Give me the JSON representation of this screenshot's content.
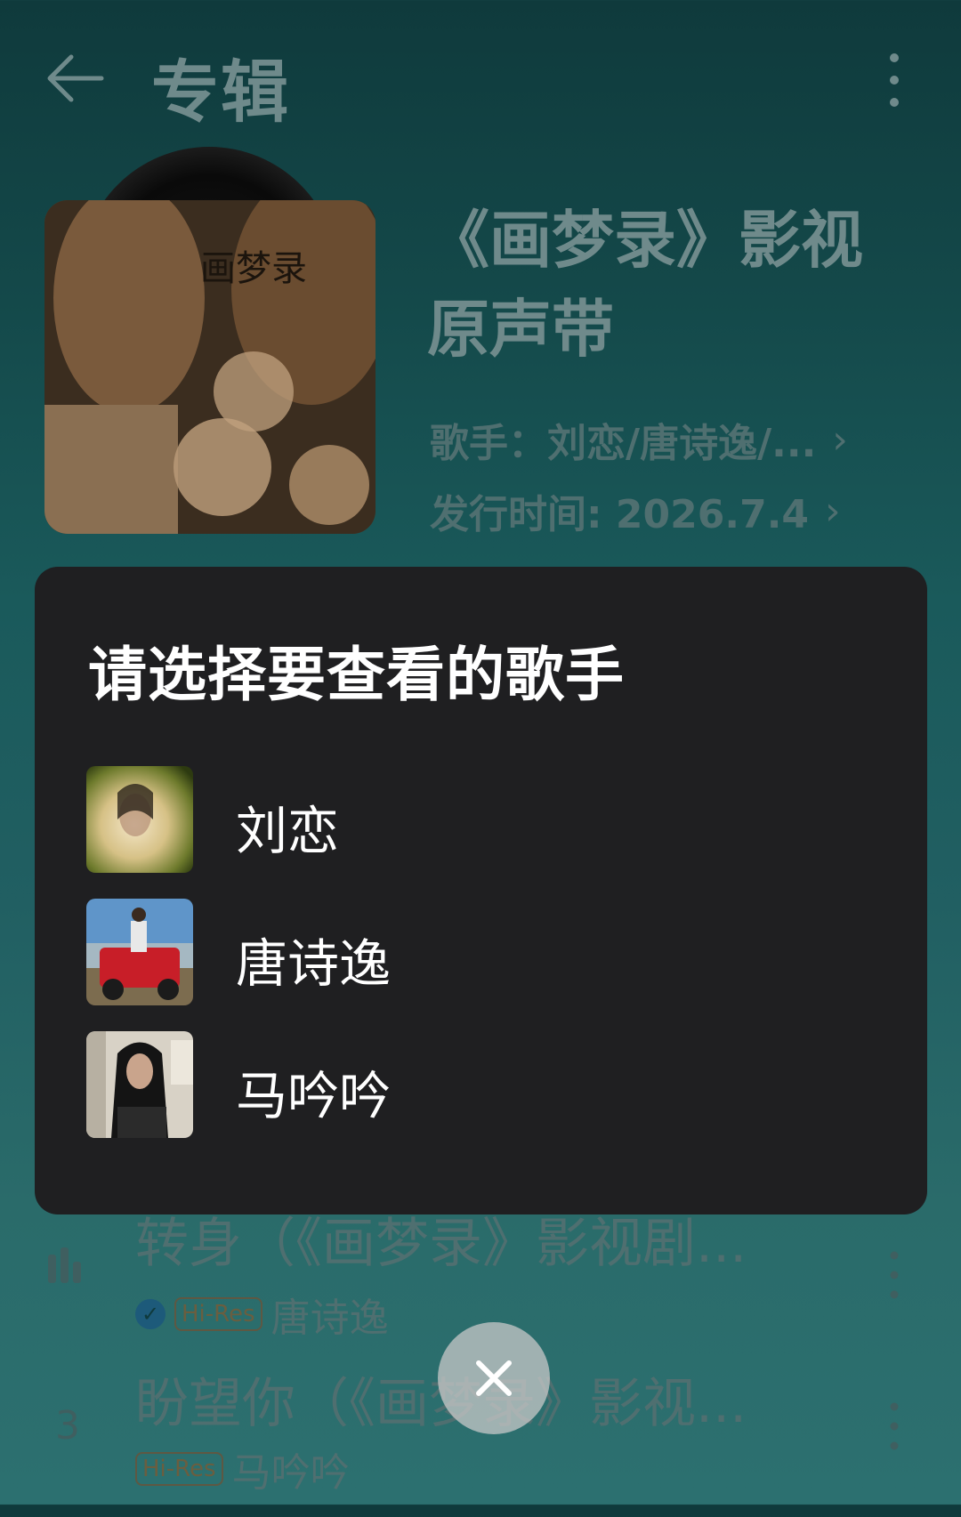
{
  "header": {
    "title": "专辑",
    "back_icon": "arrow-left-icon",
    "more_icon": "more-vertical-icon"
  },
  "album": {
    "cover_text": "画梦录",
    "title_line1": "《画梦录》影视",
    "title_line2": "原声带",
    "artist_label": "歌手：刘恋/唐诗逸/...",
    "release_label": "发行时间: 2026.7.4"
  },
  "dialog": {
    "title": "请选择要查看的歌手",
    "artists": [
      {
        "name": "刘恋"
      },
      {
        "name": "唐诗逸"
      },
      {
        "name": "马吟吟"
      }
    ]
  },
  "songs": [
    {
      "title": "转身（《画梦录》影视剧...",
      "badge": "Hi-Res",
      "artist": "唐诗逸",
      "playing": true
    },
    {
      "number": "3",
      "title": "盼望你（《画梦录》影视...",
      "badge": "Hi-Res",
      "artist": "马吟吟"
    }
  ],
  "colors": {
    "background": "#1a5a5b",
    "dialog": "#1f1f21",
    "text_muted": "#6f8a8b"
  }
}
